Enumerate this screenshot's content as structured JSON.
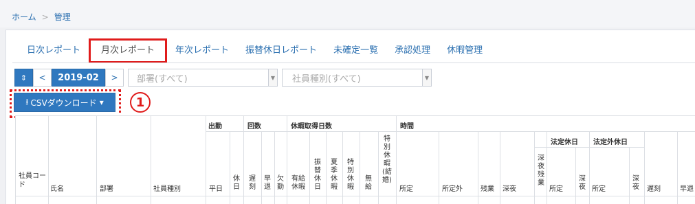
{
  "breadcrumb": {
    "home": "ホーム",
    "sep": ">",
    "current": "管理"
  },
  "tabs": [
    {
      "label": "日次レポート"
    },
    {
      "label": "月次レポート"
    },
    {
      "label": "年次レポート"
    },
    {
      "label": "振替休日レポート"
    },
    {
      "label": "未確定一覧"
    },
    {
      "label": "承認処理"
    },
    {
      "label": "休暇管理"
    }
  ],
  "toolbar": {
    "toggle_icon": "⇕",
    "prev": "<",
    "month": "2019-02",
    "next": ">",
    "department_placeholder": "部署(すべて)",
    "employee_type_placeholder": "社員種別(すべて)",
    "caret": "▼"
  },
  "csv": {
    "icon": "⭳",
    "label": "CSVダウンロード",
    "caret": "▾"
  },
  "annotation": {
    "number": "1"
  },
  "table": {
    "groups": {
      "attendance": "出勤",
      "counts": "回数",
      "leave_days": "休暇取得日数",
      "time": "時間",
      "legal_holiday": "法定休日",
      "non_legal_holiday": "法定外休日"
    },
    "cols": {
      "emp_code": "社員コード",
      "name": "氏名",
      "dept": "部署",
      "emp_type": "社員種別",
      "weekday": "平日",
      "holiday": "休日",
      "late": "遅刻",
      "early": "早退",
      "absent": "欠勤",
      "paid": "有給休暇",
      "substitute": "振替休日",
      "summer": "夏季休暇",
      "special": "特別休暇",
      "unpaid": "無給",
      "special_wedding": "特別休暇(結婚)",
      "scheduled": "所定",
      "non_scheduled": "所定外",
      "overtime": "残業",
      "late_night": "深夜",
      "late_night_overtime": "深夜残業",
      "lh_scheduled": "所定",
      "lh_night": "深夜",
      "nlh_scheduled": "所定",
      "nlh_night": "深夜",
      "late_time": "遅刻",
      "early_time": "早退"
    }
  }
}
